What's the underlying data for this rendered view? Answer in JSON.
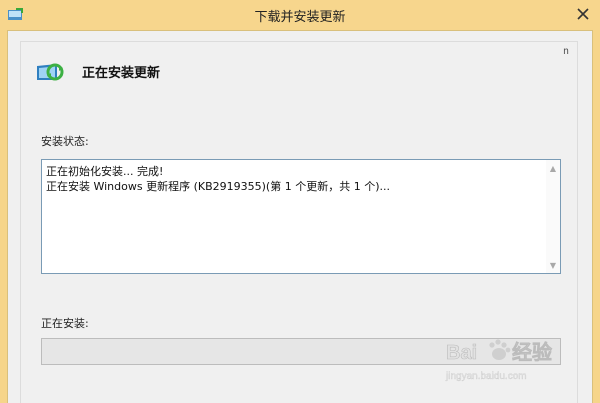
{
  "window": {
    "title": "下载并安装更新",
    "icons": {
      "app": "windows-update-icon",
      "close": "close-icon",
      "help": "help-icon"
    }
  },
  "main": {
    "heading": "正在安装更新",
    "help_glyph": "n",
    "status_label": "安装状态:",
    "status_lines": [
      "正在初始化安装... 完成!",
      "正在安装 Windows 更新程序 (KB2919355)(第 1 个更新，共 1 个)..."
    ],
    "installing_label": "正在安装:",
    "progress_fraction": 0.0
  },
  "watermark": {
    "brand": "Bai du 经验",
    "url": "jingyan.baidu.com"
  },
  "colors": {
    "title_bar": "#f7d68d",
    "client_bg": "#f0f0f0",
    "status_border": "#7a9bb5",
    "progress_track": "#e6e6e6"
  }
}
